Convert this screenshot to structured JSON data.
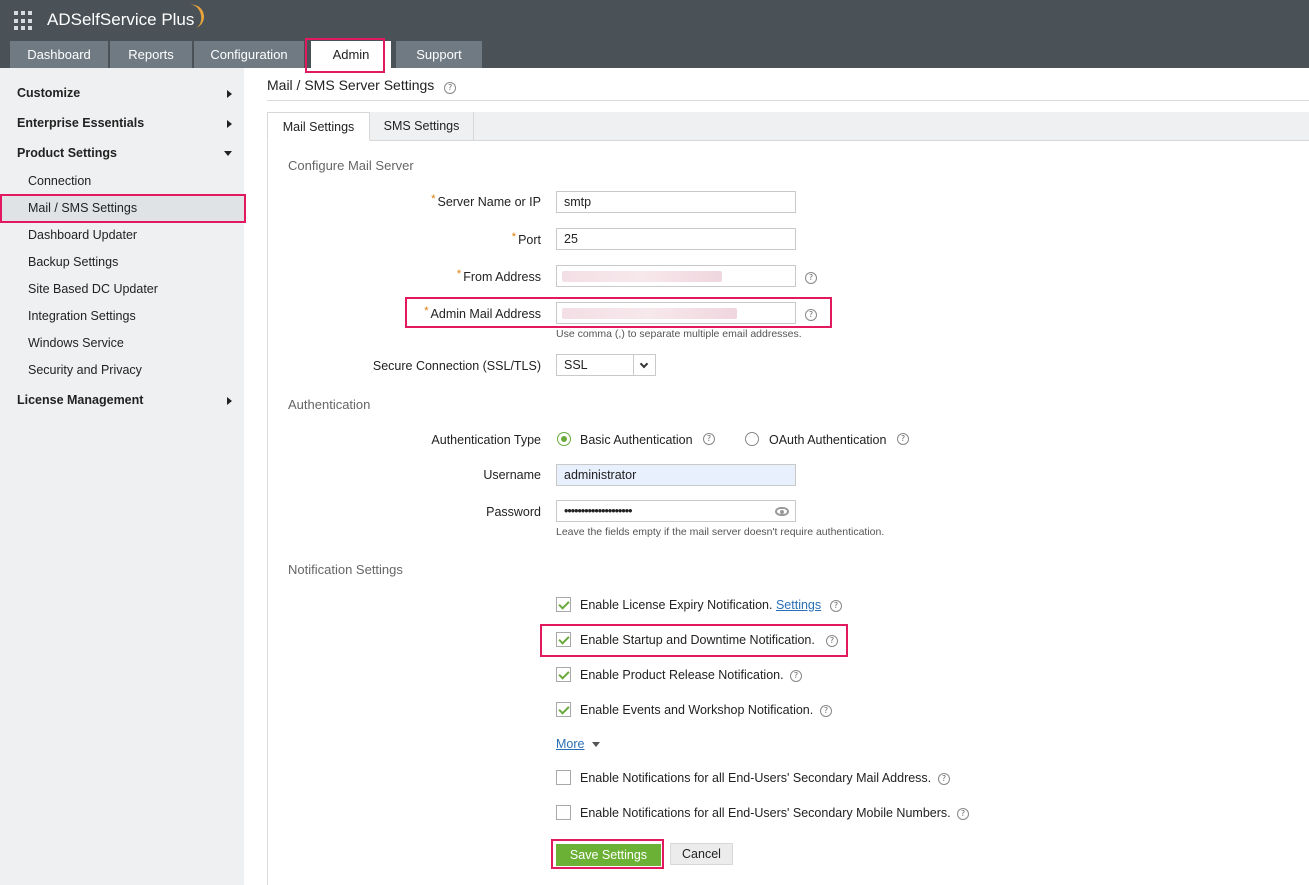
{
  "app": {
    "title": "ADSelfService Plus"
  },
  "nav": {
    "tabs": [
      "Dashboard",
      "Reports",
      "Configuration",
      "Admin",
      "Support"
    ],
    "active": "Admin"
  },
  "sidebar": {
    "sections": [
      "Customize",
      "Enterprise Essentials",
      "Product Settings",
      "License Management"
    ],
    "items": [
      "Connection",
      "Mail / SMS Settings",
      "Dashboard Updater",
      "Backup Settings",
      "Site Based DC Updater",
      "Integration Settings",
      "Windows Service",
      "Security and Privacy"
    ],
    "active_item": "Mail / SMS Settings"
  },
  "page": {
    "title": "Mail / SMS Server Settings",
    "subtabs": [
      "Mail Settings",
      "SMS Settings"
    ],
    "active_subtab": "Mail Settings"
  },
  "mail_server": {
    "heading": "Configure Mail Server",
    "server_label": "Server Name or IP",
    "server_value": "smtp",
    "port_label": "Port",
    "port_value": "25",
    "from_label": "From Address",
    "admin_label": "Admin Mail Address",
    "admin_hint": "Use comma (,) to separate multiple email addresses.",
    "secure_label": "Secure Connection (SSL/TLS)",
    "secure_value": "SSL"
  },
  "authentication": {
    "heading": "Authentication",
    "type_label": "Authentication Type",
    "basic_label": "Basic Authentication",
    "oauth_label": "OAuth Authentication",
    "selected": "Basic Authentication",
    "username_label": "Username",
    "username_value": "administrator",
    "password_label": "Password",
    "password_value": "••••••••••••••••••••",
    "hint": "Leave the fields empty if the mail server doesn't require authentication."
  },
  "notifications": {
    "heading": "Notification Settings",
    "license_label": "Enable License Expiry Notification.",
    "settings_link": "Settings",
    "startup_label": "Enable Startup and Downtime Notification.",
    "release_label": "Enable Product Release Notification.",
    "events_label": "Enable Events and Workshop Notification.",
    "more_label": "More",
    "secondary_mail_label": "Enable Notifications for all End-Users' Secondary Mail Address.",
    "secondary_mobile_label": "Enable Notifications for all End-Users' Secondary Mobile Numbers.",
    "checked": [
      true,
      true,
      true,
      true,
      false,
      false
    ]
  },
  "actions": {
    "save": "Save Settings",
    "cancel": "Cancel"
  },
  "colors": {
    "highlight": "#e2195e",
    "accent_green": "#6bb136",
    "topbar": "#4a5257",
    "nav_tab": "#6f7a82"
  }
}
